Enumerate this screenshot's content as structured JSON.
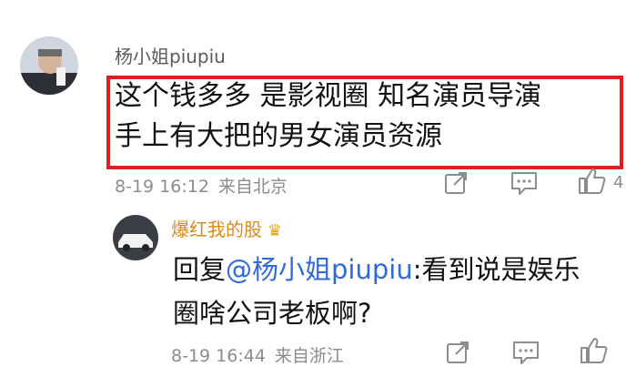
{
  "comments": [
    {
      "username": "杨小姐piupiu",
      "lines": [
        "这个钱多多 是影视圈 知名演员导演",
        "手上有大把的男女演员资源"
      ],
      "date": "8-19 16:12",
      "location": "来自北京",
      "likes": "4"
    },
    {
      "username": "爆红我的股",
      "reply_prefix": "回复",
      "mention": "@杨小姐piupiu",
      "reply_rest": ":看到说是娱乐",
      "line2": "圈啥公司老板啊?",
      "date": "8-19 16:44",
      "location": "来自浙江"
    }
  ],
  "icons": {
    "share": "share-icon",
    "reply": "comment-icon",
    "like": "thumbs-up-icon",
    "badge": "crown-badge-icon"
  },
  "colors": {
    "highlight": "#e02020",
    "mention": "#2f6bd8",
    "vip_name": "#d98a1d",
    "meta": "#8c8c8c"
  }
}
